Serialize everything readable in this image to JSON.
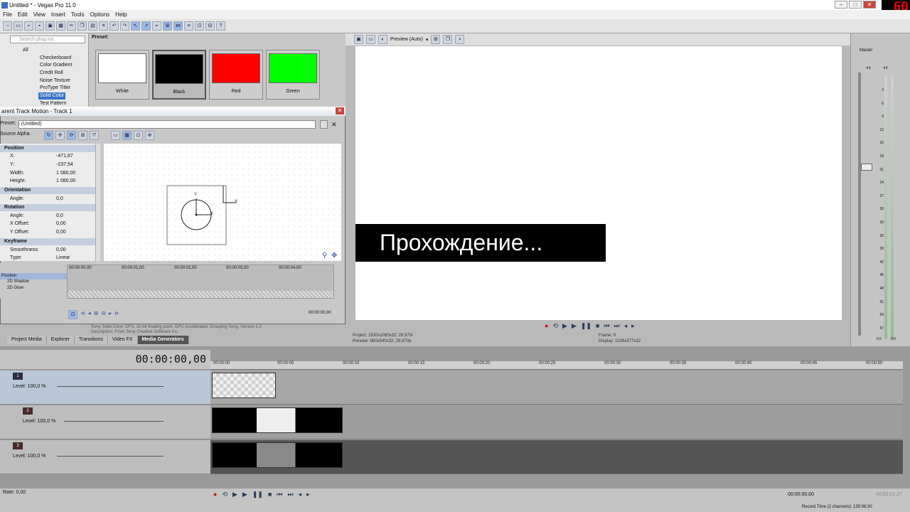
{
  "app": {
    "title": "Untitled * - Vegas Pro 11.0",
    "fps": "60"
  },
  "menu": [
    "File",
    "Edit",
    "View",
    "Insert",
    "Tools",
    "Options",
    "Help"
  ],
  "tree": {
    "search_placeholder": "Search plug-ins",
    "root": "All",
    "items": [
      "Checkerboard",
      "Color Gradient",
      "Credit Roll",
      "Noise Texture",
      "ProType Titler",
      "Solid Color",
      "Test Pattern"
    ],
    "selected": 5
  },
  "presets": {
    "label": "Preset:",
    "items": [
      {
        "name": "White",
        "color": "#ffffff"
      },
      {
        "name": "Black",
        "color": "#000000"
      },
      {
        "name": "Red",
        "color": "#ff0000"
      },
      {
        "name": "Green",
        "color": "#00ff00"
      }
    ]
  },
  "dialog": {
    "title": "arent Track Motion - Track 1",
    "preset_label": "Preset:",
    "preset_value": "(Untitled)",
    "source_alpha": "Source Alpha",
    "groups": [
      {
        "name": "Position",
        "props": [
          [
            "X:",
            "-471,87"
          ],
          [
            "Y:",
            "-237,54"
          ],
          [
            "Width:",
            "1 080,00"
          ],
          [
            "Height:",
            "1 080,00"
          ]
        ]
      },
      {
        "name": "Orientation",
        "props": [
          [
            "Angle:",
            "0,0"
          ]
        ]
      },
      {
        "name": "Rotation",
        "props": [
          [
            "Angle:",
            "0,0"
          ],
          [
            "X Offset:",
            "0,00"
          ],
          [
            "Y Offset:",
            "0,00"
          ]
        ]
      },
      {
        "name": "Keyframe",
        "props": [
          [
            "Smoothness:",
            "0,00"
          ],
          [
            "Type:",
            "Linear"
          ]
        ]
      }
    ],
    "kf_times": [
      "00:00:00,00",
      "00:00:01,00",
      "00:00:02,00",
      "00:00:03,00",
      "00:00:04,00"
    ],
    "kf_tracks": [
      "Position",
      "2D Shadow",
      "2D Glow"
    ],
    "kf_end_time": "00:00:00,00",
    "axis_x": "X",
    "axis_y": "Y"
  },
  "tabs": [
    "Project Media",
    "Explorer",
    "Transitions",
    "Video FX",
    "Media Generators"
  ],
  "tabs_active": 4,
  "desc": {
    "line1": "Sony Solid Color: OFX, 32-bit floating point, GPU Accelerated, Grouping Sony, Version 1.0",
    "line2": "Description: From Sony Creative Software Inc."
  },
  "preview": {
    "mode": "Preview (Auto)",
    "caption": "Прохождение...",
    "project_label": "Project:",
    "project_value": "1920x1080x32; 29,970i",
    "previewres_label": "Preview:",
    "previewres_value": "960x540x32; 29,970p",
    "frame_label": "Frame:",
    "frame_value": "0",
    "display_label": "Display:",
    "display_value": "1026x577x32"
  },
  "mixer": {
    "title": "Master",
    "left_label": "-Inf.",
    "right_label": "-Inf.",
    "scale": [
      "3",
      "6",
      "9",
      "12",
      "15",
      "18",
      "21",
      "24",
      "27",
      "30",
      "33",
      "36",
      "39",
      "42",
      "45",
      "48",
      "51",
      "54",
      "57"
    ],
    "bottom_l": "0.0",
    "bottom_r": "0.0"
  },
  "timeline": {
    "timecode": "00:00:00,00",
    "marks": [
      "00:00:00",
      "00:00:05",
      "00:00:10",
      "00:00:15",
      "00:00:20",
      "00:00:25",
      "00:00:30",
      "00:00:35",
      "00:00:40",
      "00:00:45",
      "00:00:50"
    ],
    "tracks": [
      {
        "num": "1",
        "level": "Level: 100,0 %"
      },
      {
        "num": "2",
        "level": "Level: 100,0 %"
      },
      {
        "num": "3",
        "level": "Level: 100,0 %"
      }
    ],
    "rate": "Rate: 0,00",
    "end_time": "00:00:00,00",
    "length": "00:00:01,27",
    "record": "Record Time (2 channels): 135:06:30"
  }
}
